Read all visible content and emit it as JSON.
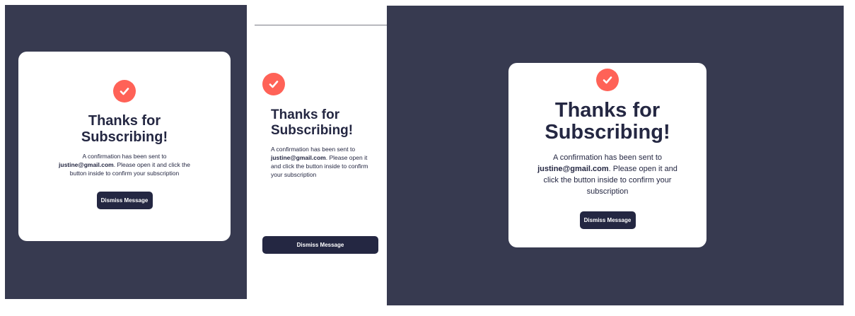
{
  "confirmation": {
    "title_line1": "Thanks for",
    "title_line2": "Subscribing!",
    "desc_prefix": "A confirmation has been sent to ",
    "email": "justine@gmail.com",
    "desc_suffix": ". Please open it and click the button inside to confirm your subscription",
    "button_label": "Dismiss Message",
    "check_icon": "check-circle-icon"
  },
  "colors": {
    "overlay": "#373a50",
    "card": "#ffffff",
    "accent": "#ff6257",
    "primary_dark": "#242742"
  }
}
